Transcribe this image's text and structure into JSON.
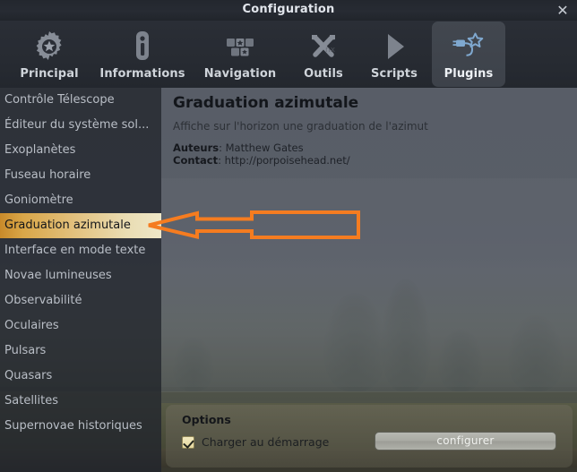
{
  "window": {
    "title": "Configuration",
    "close_icon": "close-x-icon"
  },
  "tabs": [
    {
      "label": "Principal",
      "icon": "gear-star-icon",
      "active": false
    },
    {
      "label": "Informations",
      "icon": "info-badge-icon",
      "active": false
    },
    {
      "label": "Navigation",
      "icon": "grid-stars-icon",
      "active": false
    },
    {
      "label": "Outils",
      "icon": "wrench-hammer-icon",
      "active": false
    },
    {
      "label": "Scripts",
      "icon": "play-triangle-icon",
      "active": false
    },
    {
      "label": "Plugins",
      "icon": "plug-star-icon",
      "active": true
    }
  ],
  "sidebar": {
    "items": [
      {
        "label": "Contrôle Télescope",
        "selected": false
      },
      {
        "label": "Éditeur du système sol...",
        "selected": false
      },
      {
        "label": "Exoplanètes",
        "selected": false
      },
      {
        "label": "Fuseau horaire",
        "selected": false
      },
      {
        "label": "Goniomètre",
        "selected": false
      },
      {
        "label": "Graduation azimutale",
        "selected": true
      },
      {
        "label": "Interface en mode texte",
        "selected": false
      },
      {
        "label": "Novae lumineuses",
        "selected": false
      },
      {
        "label": "Observabilité",
        "selected": false
      },
      {
        "label": "Oculaires",
        "selected": false
      },
      {
        "label": "Pulsars",
        "selected": false
      },
      {
        "label": "Quasars",
        "selected": false
      },
      {
        "label": "Satellites",
        "selected": false
      },
      {
        "label": "Supernovae historiques",
        "selected": false
      }
    ]
  },
  "plugin": {
    "title": "Graduation azimutale",
    "description": "Affiche sur l'horizon une graduation de l'azimut",
    "authors_label": "Auteurs",
    "authors_value": ": Matthew Gates",
    "contact_label": "Contact",
    "contact_value": ": http://porpoisehead.net/"
  },
  "options": {
    "title": "Options",
    "load_at_startup_label": "Charger au démarrage",
    "load_at_startup_checked": true,
    "configure_label": "configurer"
  },
  "annotation": {
    "arrow": "left-pointing-arrow",
    "color": "#F57C20"
  },
  "colors": {
    "accent_orange": "#F57C20",
    "selection_gradient_start": "#C98A2A",
    "selection_gradient_end": "#EFE7C8",
    "tab_active_bg": "#42474F",
    "titlebar_bg": "#23272E",
    "plugin_icon_blue": "#7FA8CF"
  }
}
